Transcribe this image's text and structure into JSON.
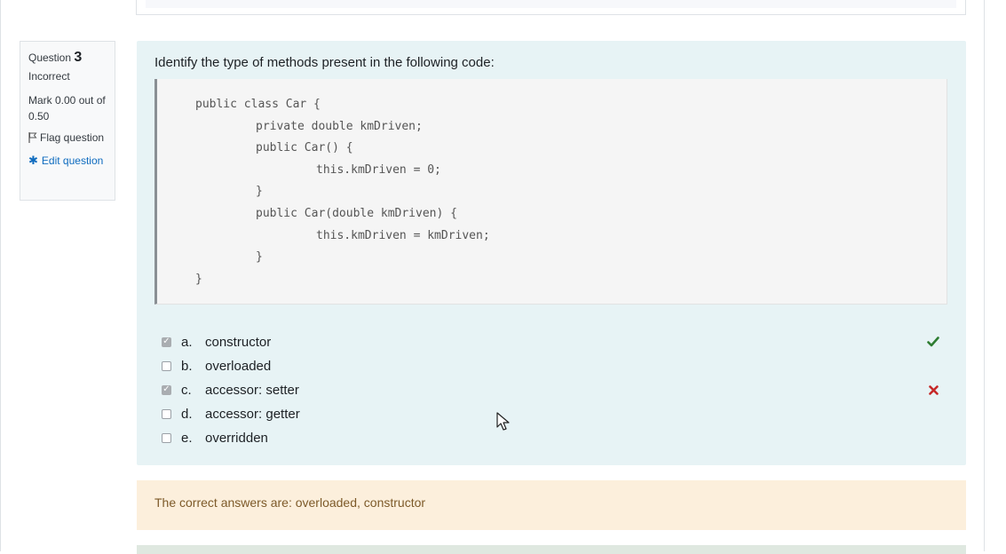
{
  "info": {
    "question_label": "Question",
    "question_number": "3",
    "state": "Incorrect",
    "grade": "Mark 0.00 out of 0.50",
    "flag_label": "Flag question",
    "edit_label": "Edit question"
  },
  "question": {
    "text": "Identify the type of methods present in the following code:",
    "code_lines": [
      "public class Car {",
      "private double kmDriven;",
      "public Car() {",
      "this.kmDriven = 0;",
      "}",
      "public Car(double kmDriven) {",
      "this.kmDriven = kmDriven;",
      "}",
      "}"
    ]
  },
  "answers": [
    {
      "letter": "a.",
      "label": "constructor",
      "checked": true,
      "result": "correct"
    },
    {
      "letter": "b.",
      "label": "overloaded",
      "checked": false,
      "result": ""
    },
    {
      "letter": "c.",
      "label": "accessor: setter",
      "checked": true,
      "result": "incorrect"
    },
    {
      "letter": "d.",
      "label": "accessor: getter",
      "checked": false,
      "result": ""
    },
    {
      "letter": "e.",
      "label": "overridden",
      "checked": false,
      "result": ""
    }
  ],
  "feedback": {
    "text": "The correct answers are: overloaded, constructor"
  },
  "colors": {
    "correct": "#2e7d32",
    "incorrect": "#c62828",
    "link": "#0f6cbf"
  }
}
